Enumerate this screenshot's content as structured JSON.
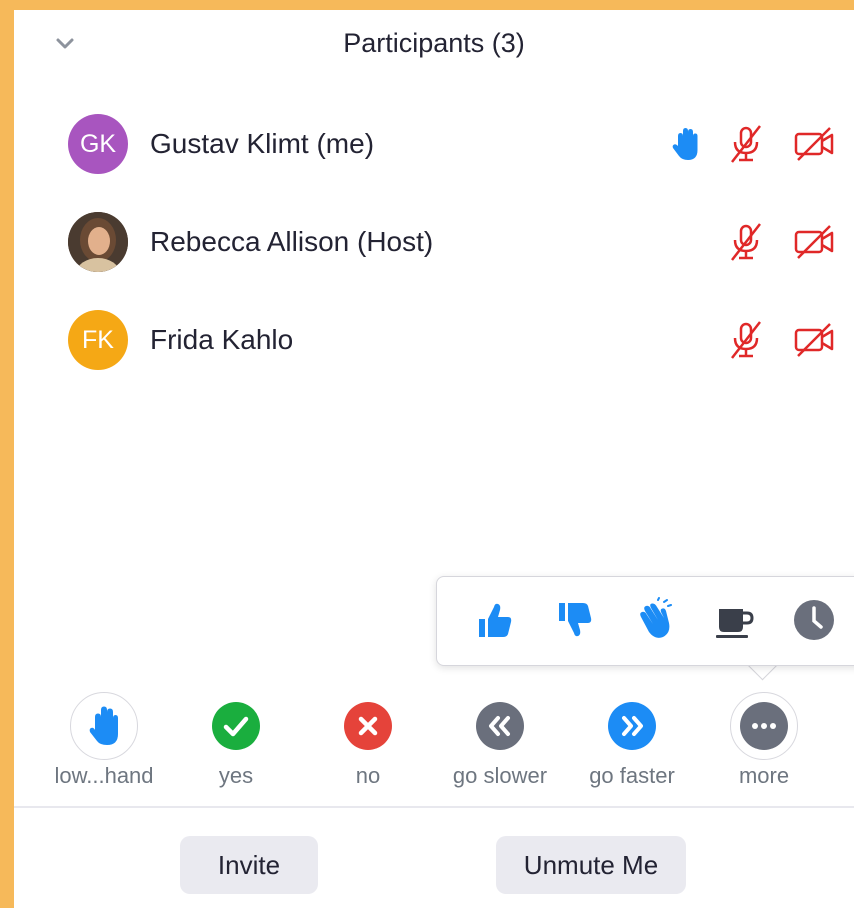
{
  "header": {
    "title": "Participants (3)"
  },
  "participants": [
    {
      "name": "Gustav Klimt (me)",
      "initials": "GK",
      "avatar_color": "#a855bf",
      "hand_raised": true
    },
    {
      "name": "Rebecca Allison (Host)",
      "initials": "",
      "avatar_color": "#5b4a3e",
      "hand_raised": false
    },
    {
      "name": "Frida Kahlo",
      "initials": "FK",
      "avatar_color": "#f5a815",
      "hand_raised": false
    }
  ],
  "more_popup": {
    "icons": [
      "thumbs-up-icon",
      "thumbs-down-icon",
      "clap-icon",
      "coffee-icon",
      "clock-icon"
    ]
  },
  "reactions": [
    {
      "label": "low...hand",
      "icon": "raised-hand-icon"
    },
    {
      "label": "yes",
      "icon": "check-icon",
      "color": "#1aae3e"
    },
    {
      "label": "no",
      "icon": "x-icon",
      "color": "#e5433a"
    },
    {
      "label": "go slower",
      "icon": "rewind-icon",
      "color": "#6a6f7c"
    },
    {
      "label": "go faster",
      "icon": "fast-forward-icon",
      "color": "#1c8cf5"
    },
    {
      "label": "more",
      "icon": "more-icon",
      "color": "#6a6f7c"
    }
  ],
  "footer": {
    "invite_label": "Invite",
    "unmute_label": "Unmute Me"
  },
  "colors": {
    "accent_blue": "#1c8cf5",
    "muted_red": "#e02828",
    "frame_orange": "#f6b95a"
  }
}
